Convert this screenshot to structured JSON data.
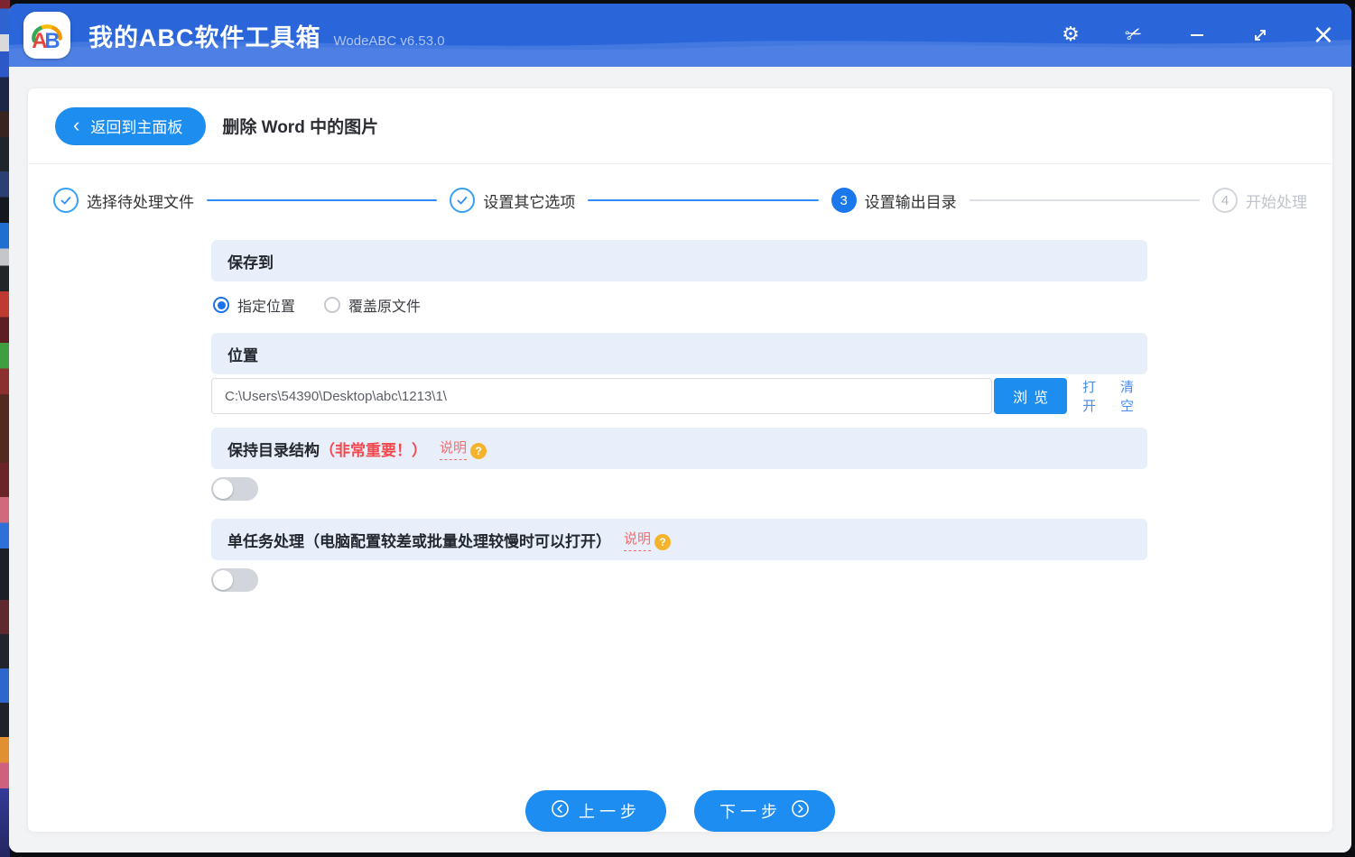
{
  "window": {
    "title": "我的ABC软件工具箱",
    "version": "WodeABC v6.53.0"
  },
  "header": {
    "back_label": "返回到主面板",
    "page_title": "删除 Word 中的图片"
  },
  "steps": [
    {
      "label": "选择待处理文件",
      "state": "done"
    },
    {
      "label": "设置其它选项",
      "state": "done"
    },
    {
      "label": "设置输出目录",
      "state": "active",
      "number": "3"
    },
    {
      "label": "开始处理",
      "state": "pending",
      "number": "4"
    }
  ],
  "save_to": {
    "header": "保存到",
    "options": [
      {
        "label": "指定位置",
        "selected": true
      },
      {
        "label": "覆盖原文件",
        "selected": false
      }
    ]
  },
  "location": {
    "header": "位置",
    "path": "C:\\Users\\54390\\Desktop\\abc\\1213\\1\\",
    "browse_label": "浏览",
    "open_label": "打开",
    "clear_label": "清空"
  },
  "keep_structure": {
    "title": "保持目录结构",
    "important": "（非常重要！）",
    "help_label": "说明",
    "help_mark": "?",
    "enabled": false
  },
  "single_task": {
    "title": "单任务处理（电脑配置较差或批量处理较慢时可以打开）",
    "help_label": "说明",
    "help_mark": "?",
    "enabled": false
  },
  "footer": {
    "prev_label": "上一步",
    "next_label": "下一步"
  },
  "colors": {
    "accent_blue": "#1d8df0",
    "titlebar_blue": "#2a66d9",
    "section_bg": "#e9effa",
    "important_red": "#f2484f",
    "help_red": "#f56c6c",
    "help_yellow": "#f5b32d",
    "step_done_blue": "#2f8ef5",
    "step_active_blue": "#1a78ec"
  }
}
